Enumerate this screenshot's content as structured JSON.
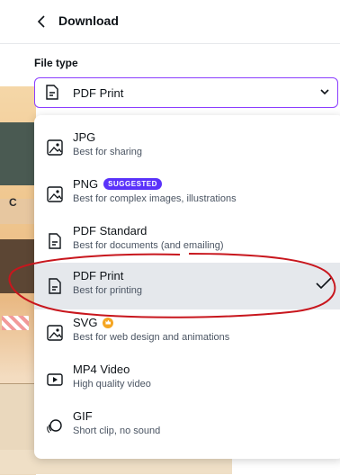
{
  "header": {
    "title": "Download",
    "back_icon": "chevron-left-icon"
  },
  "file_type": {
    "label": "File type",
    "selected": "PDF Print"
  },
  "menu": {
    "items": [
      {
        "name": "JPG",
        "desc": "Best for sharing",
        "icon": "image-icon"
      },
      {
        "name": "PNG",
        "desc": "Best for complex images, illustrations",
        "icon": "image-icon",
        "badge": "SUGGESTED"
      },
      {
        "name": "PDF Standard",
        "desc": "Best for documents (and emailing)",
        "icon": "document-icon"
      },
      {
        "name": "PDF Print",
        "desc": "Best for printing",
        "icon": "document-icon",
        "selected": true
      },
      {
        "name": "SVG",
        "desc": "Best for web design and animations",
        "icon": "image-icon",
        "pro": true
      },
      {
        "name": "MP4 Video",
        "desc": "High quality video",
        "icon": "video-icon"
      },
      {
        "name": "GIF",
        "desc": "Short clip, no sound",
        "icon": "gif-icon"
      }
    ]
  },
  "background_art": {
    "letter": "C"
  },
  "colors": {
    "accent": "#8b3dff",
    "badge": "#5a32fa",
    "annotation": "#c8161d",
    "selected_bg": "#e5e8ec"
  }
}
